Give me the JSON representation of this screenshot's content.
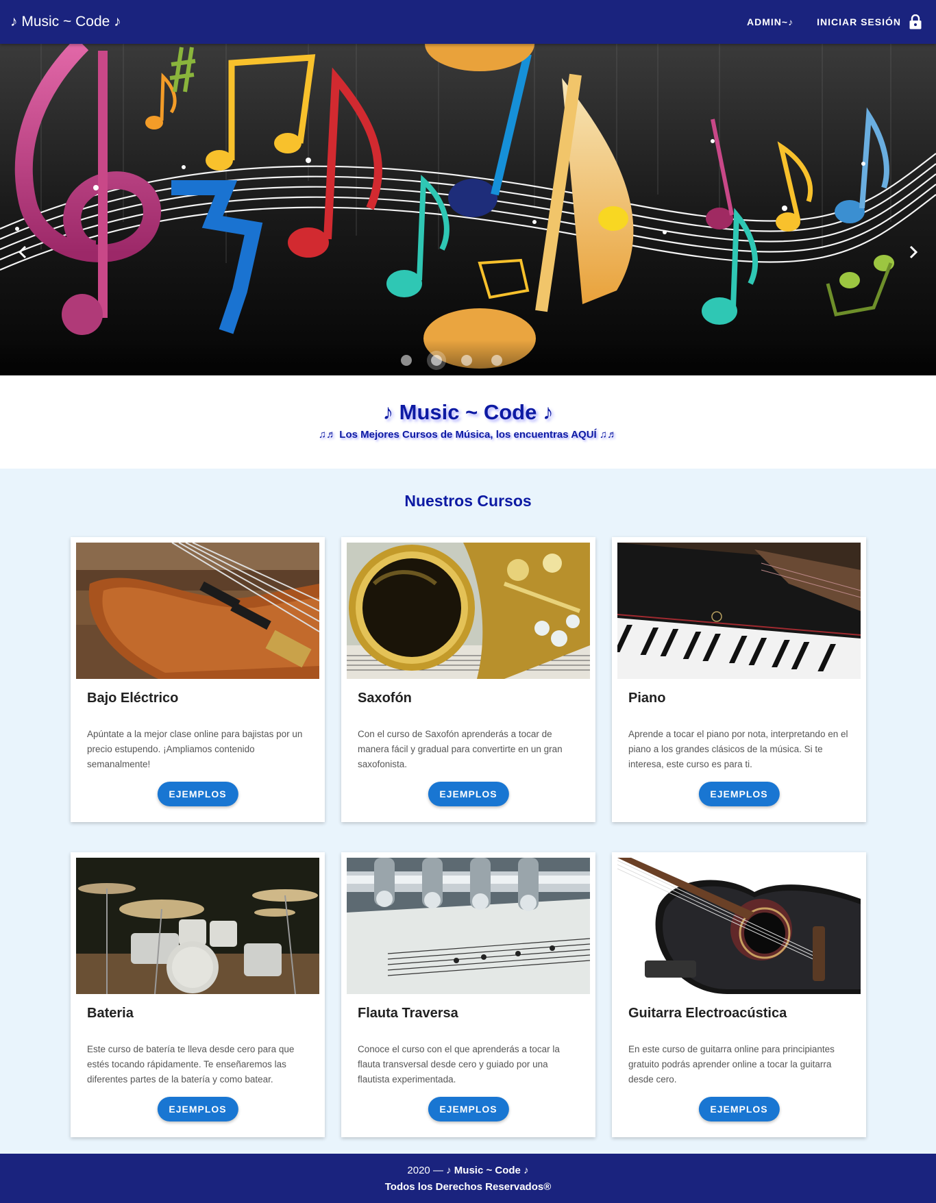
{
  "navbar": {
    "brand": "♪ Music ~ Code ♪",
    "admin_label": "ADMIN~♪",
    "login_label": "INICIAR SESIÓN",
    "lock_icon": "lock-icon",
    "background": "#1a237e"
  },
  "hero": {
    "slides": 4,
    "active_slide": 2,
    "prev_icon": "chevron-left-icon",
    "next_icon": "chevron-right-icon"
  },
  "intro": {
    "title": "♪ Music ~ Code ♪",
    "subtitle": "♫♬ Los Mejores Cursos de Música, los encuentras AQUÍ ♫♬"
  },
  "courses": {
    "heading": "Nuestros Cursos",
    "button_label": "EJEMPLOS",
    "items": [
      {
        "title": "Bajo Eléctrico",
        "text": "Apúntate a la mejor clase online para bajistas por un precio estupendo. ¡Ampliamos contenido semanalmente!"
      },
      {
        "title": "Saxofón",
        "text": "Con el curso de Saxofón aprenderás a tocar de manera fácil y gradual para convertirte en un gran saxofonista."
      },
      {
        "title": "Piano",
        "text": "Aprende a tocar el piano por nota, interpretando en el piano a los grandes clásicos de la música. Si te interesa, este curso es para ti."
      },
      {
        "title": "Bateria",
        "text": "Este curso de batería te lleva desde cero para que estés tocando rápidamente. Te enseñaremos las diferentes partes de la batería y como batear."
      },
      {
        "title": "Flauta Traversa",
        "text": "Conoce el curso con el que aprenderás a tocar la flauta transversal desde cero y guiado por una flautista experimentada."
      },
      {
        "title": "Guitarra Electroacústica",
        "text": "En este curso de guitarra online para principiantes gratuito podrás aprender online a tocar la guitarra desde cero."
      }
    ]
  },
  "footer": {
    "year_prefix": "2020 —",
    "brand": "♪ Music ~ Code ♪",
    "rights": "Todos los Derechos Reservados®"
  },
  "colors": {
    "primary": "#1a237e",
    "accent": "#1976d2",
    "title_blue": "#0d1aa3",
    "page_bg": "#e9f4fc"
  }
}
